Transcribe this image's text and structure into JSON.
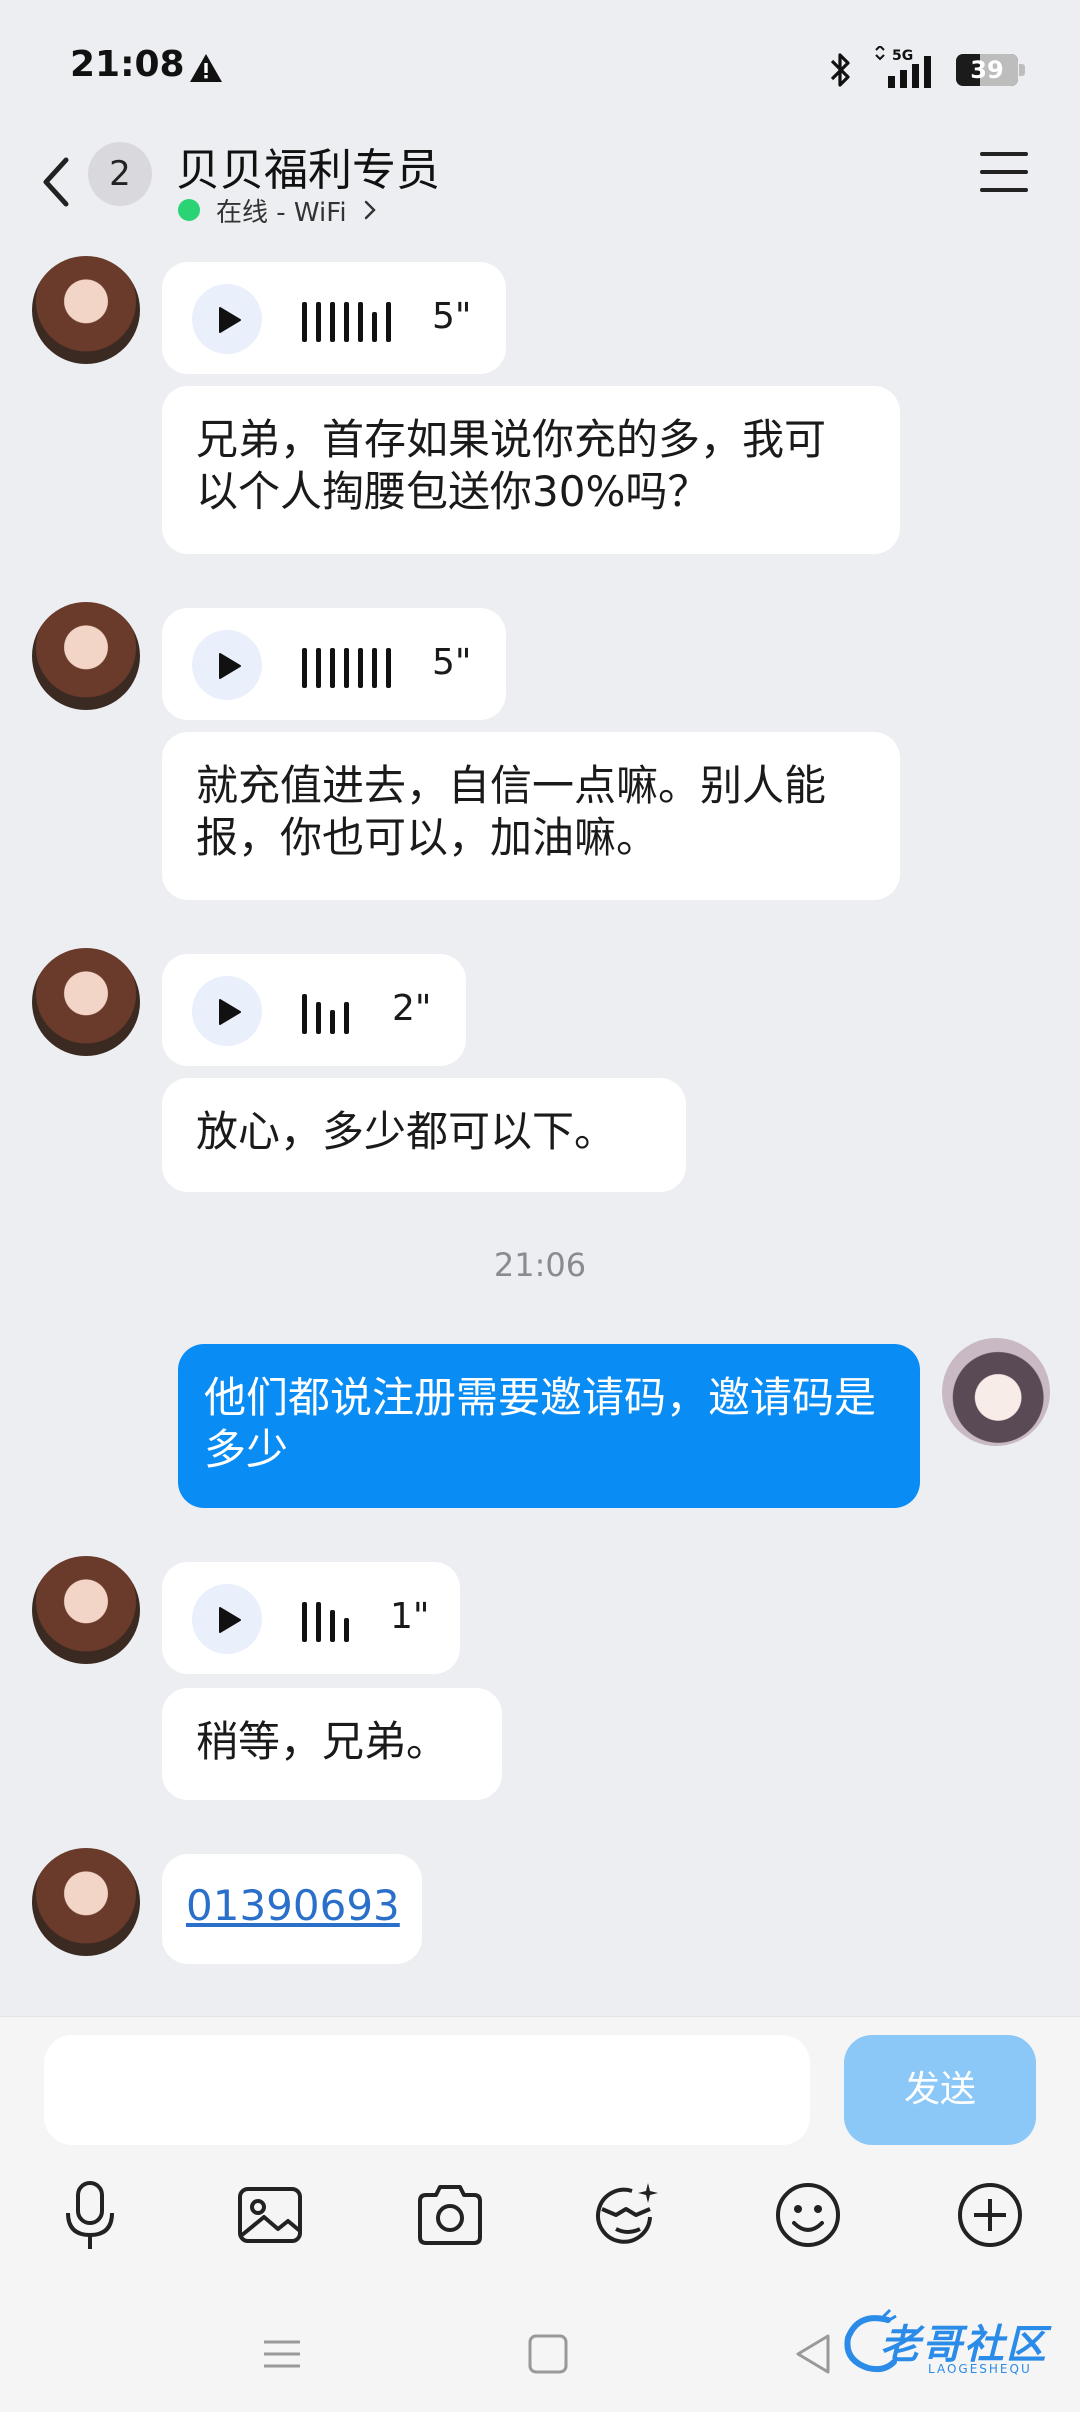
{
  "status_bar": {
    "time": "21:08",
    "network": "5G",
    "battery": "39",
    "battery_level": 0.39
  },
  "header": {
    "unread_count": "2",
    "contact_name": "贝贝福利专员",
    "online_status": "在线 - WiFi"
  },
  "messages": [
    {
      "sender": "other",
      "type": "voice",
      "duration": "5\""
    },
    {
      "sender": "other",
      "type": "text",
      "text": "兄弟，首存如果说你充的多，我可以个人掏腰包送你30%吗？"
    },
    {
      "sender": "other",
      "type": "voice",
      "duration": "5\""
    },
    {
      "sender": "other",
      "type": "text",
      "text": "就充值进去，自信一点嘛。别人能报，你也可以，加油嘛。"
    },
    {
      "sender": "other",
      "type": "voice",
      "duration": "2\""
    },
    {
      "sender": "other",
      "type": "text",
      "text": "放心，多少都可以下。"
    },
    {
      "sender": "me",
      "type": "text",
      "text": "他们都说注册需要邀请码，邀请码是多少"
    },
    {
      "sender": "other",
      "type": "voice",
      "duration": "1\""
    },
    {
      "sender": "other",
      "type": "text",
      "text": "稍等，兄弟。"
    },
    {
      "sender": "other",
      "type": "link",
      "text": "01390693"
    }
  ],
  "time_separator": "21:06",
  "composer": {
    "input_value": "",
    "send_label": "发送"
  },
  "toolbar": [
    "microphone-icon",
    "image-icon",
    "camera-icon",
    "face-filter-icon",
    "emoji-icon",
    "plus-icon"
  ],
  "watermark": {
    "text": "老哥社区",
    "sub": "LAOGESHEQU"
  },
  "colors": {
    "my_bubble": "#0a8cf5",
    "send_button": "#8cc8f7",
    "online_dot": "#2ad374",
    "link": "#2a6fc9"
  }
}
